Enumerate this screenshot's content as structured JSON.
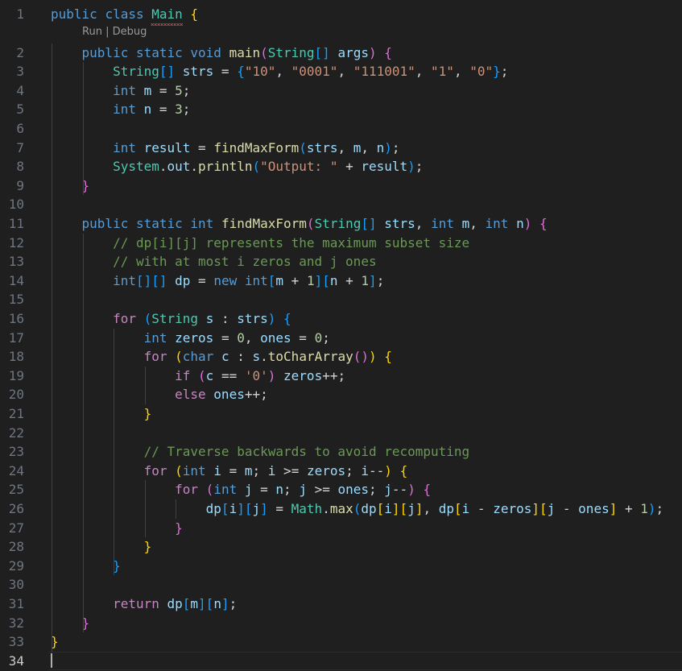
{
  "editor": {
    "language": "java",
    "codelens": {
      "run": "Run",
      "separator": " | ",
      "debug": "Debug"
    },
    "active_line": 34,
    "error_squiggle_on": "Main",
    "lines": [
      {
        "n": "1",
        "tokens": [
          [
            "kw",
            "public"
          ],
          [
            "pl",
            " "
          ],
          [
            "kw",
            "class"
          ],
          [
            "pl",
            " "
          ],
          [
            "ty",
            "Main"
          ],
          [
            "pl",
            " "
          ],
          [
            "b1",
            "{"
          ]
        ]
      },
      {
        "n": "2",
        "tokens": [
          [
            "pl",
            "    "
          ],
          [
            "kw",
            "public"
          ],
          [
            "pl",
            " "
          ],
          [
            "kw",
            "static"
          ],
          [
            "pl",
            " "
          ],
          [
            "kw",
            "void"
          ],
          [
            "pl",
            " "
          ],
          [
            "fn",
            "main"
          ],
          [
            "b2",
            "("
          ],
          [
            "ty",
            "String"
          ],
          [
            "b3",
            "[]"
          ],
          [
            "pl",
            " "
          ],
          [
            "var",
            "args"
          ],
          [
            "b2",
            ")"
          ],
          [
            "pl",
            " "
          ],
          [
            "b2",
            "{"
          ]
        ]
      },
      {
        "n": "3",
        "tokens": [
          [
            "pl",
            "        "
          ],
          [
            "ty",
            "String"
          ],
          [
            "b3",
            "[]"
          ],
          [
            "pl",
            " "
          ],
          [
            "var",
            "strs"
          ],
          [
            "pl",
            " = "
          ],
          [
            "b3",
            "{"
          ],
          [
            "str",
            "\"10\""
          ],
          [
            "pl",
            ", "
          ],
          [
            "str",
            "\"0001\""
          ],
          [
            "pl",
            ", "
          ],
          [
            "str",
            "\"111001\""
          ],
          [
            "pl",
            ", "
          ],
          [
            "str",
            "\"1\""
          ],
          [
            "pl",
            ", "
          ],
          [
            "str",
            "\"0\""
          ],
          [
            "b3",
            "}"
          ],
          [
            "pl",
            ";"
          ]
        ]
      },
      {
        "n": "4",
        "tokens": [
          [
            "pl",
            "        "
          ],
          [
            "kw",
            "int"
          ],
          [
            "pl",
            " "
          ],
          [
            "var",
            "m"
          ],
          [
            "pl",
            " = "
          ],
          [
            "num",
            "5"
          ],
          [
            "pl",
            ";"
          ]
        ]
      },
      {
        "n": "5",
        "tokens": [
          [
            "pl",
            "        "
          ],
          [
            "kw",
            "int"
          ],
          [
            "pl",
            " "
          ],
          [
            "var",
            "n"
          ],
          [
            "pl",
            " = "
          ],
          [
            "num",
            "3"
          ],
          [
            "pl",
            ";"
          ]
        ]
      },
      {
        "n": "6",
        "tokens": []
      },
      {
        "n": "7",
        "tokens": [
          [
            "pl",
            "        "
          ],
          [
            "kw",
            "int"
          ],
          [
            "pl",
            " "
          ],
          [
            "var",
            "result"
          ],
          [
            "pl",
            " = "
          ],
          [
            "fn",
            "findMaxForm"
          ],
          [
            "b3",
            "("
          ],
          [
            "var",
            "strs"
          ],
          [
            "pl",
            ", "
          ],
          [
            "var",
            "m"
          ],
          [
            "pl",
            ", "
          ],
          [
            "var",
            "n"
          ],
          [
            "b3",
            ")"
          ],
          [
            "pl",
            ";"
          ]
        ]
      },
      {
        "n": "8",
        "tokens": [
          [
            "pl",
            "        "
          ],
          [
            "ty",
            "System"
          ],
          [
            "pl",
            "."
          ],
          [
            "var",
            "out"
          ],
          [
            "pl",
            "."
          ],
          [
            "fn",
            "println"
          ],
          [
            "b3",
            "("
          ],
          [
            "str",
            "\"Output: \""
          ],
          [
            "pl",
            " + "
          ],
          [
            "var",
            "result"
          ],
          [
            "b3",
            ")"
          ],
          [
            "pl",
            ";"
          ]
        ]
      },
      {
        "n": "9",
        "tokens": [
          [
            "pl",
            "    "
          ],
          [
            "b2",
            "}"
          ]
        ]
      },
      {
        "n": "10",
        "tokens": []
      },
      {
        "n": "11",
        "tokens": [
          [
            "pl",
            "    "
          ],
          [
            "kw",
            "public"
          ],
          [
            "pl",
            " "
          ],
          [
            "kw",
            "static"
          ],
          [
            "pl",
            " "
          ],
          [
            "kw",
            "int"
          ],
          [
            "pl",
            " "
          ],
          [
            "fn",
            "findMaxForm"
          ],
          [
            "b2",
            "("
          ],
          [
            "ty",
            "String"
          ],
          [
            "b3",
            "[]"
          ],
          [
            "pl",
            " "
          ],
          [
            "var",
            "strs"
          ],
          [
            "pl",
            ", "
          ],
          [
            "kw",
            "int"
          ],
          [
            "pl",
            " "
          ],
          [
            "var",
            "m"
          ],
          [
            "pl",
            ", "
          ],
          [
            "kw",
            "int"
          ],
          [
            "pl",
            " "
          ],
          [
            "var",
            "n"
          ],
          [
            "b2",
            ")"
          ],
          [
            "pl",
            " "
          ],
          [
            "b2",
            "{"
          ]
        ]
      },
      {
        "n": "12",
        "tokens": [
          [
            "pl",
            "        "
          ],
          [
            "cm",
            "// dp[i][j] represents the maximum subset size"
          ]
        ]
      },
      {
        "n": "13",
        "tokens": [
          [
            "pl",
            "        "
          ],
          [
            "cm",
            "// with at most i zeros and j ones"
          ]
        ]
      },
      {
        "n": "14",
        "tokens": [
          [
            "pl",
            "        "
          ],
          [
            "kw",
            "int"
          ],
          [
            "b3",
            "[][]"
          ],
          [
            "pl",
            " "
          ],
          [
            "var",
            "dp"
          ],
          [
            "pl",
            " = "
          ],
          [
            "kw",
            "new"
          ],
          [
            "pl",
            " "
          ],
          [
            "kw",
            "int"
          ],
          [
            "b3",
            "["
          ],
          [
            "var",
            "m"
          ],
          [
            "pl",
            " + "
          ],
          [
            "num",
            "1"
          ],
          [
            "b3",
            "]["
          ],
          [
            "var",
            "n"
          ],
          [
            "pl",
            " + "
          ],
          [
            "num",
            "1"
          ],
          [
            "b3",
            "]"
          ],
          [
            "pl",
            ";"
          ]
        ]
      },
      {
        "n": "15",
        "tokens": []
      },
      {
        "n": "16",
        "tokens": [
          [
            "pl",
            "        "
          ],
          [
            "ctl",
            "for"
          ],
          [
            "pl",
            " "
          ],
          [
            "b3",
            "("
          ],
          [
            "ty",
            "String"
          ],
          [
            "pl",
            " "
          ],
          [
            "var",
            "s"
          ],
          [
            "pl",
            " : "
          ],
          [
            "var",
            "strs"
          ],
          [
            "b3",
            ")"
          ],
          [
            "pl",
            " "
          ],
          [
            "b3",
            "{"
          ]
        ]
      },
      {
        "n": "17",
        "tokens": [
          [
            "pl",
            "            "
          ],
          [
            "kw",
            "int"
          ],
          [
            "pl",
            " "
          ],
          [
            "var",
            "zeros"
          ],
          [
            "pl",
            " = "
          ],
          [
            "num",
            "0"
          ],
          [
            "pl",
            ", "
          ],
          [
            "var",
            "ones"
          ],
          [
            "pl",
            " = "
          ],
          [
            "num",
            "0"
          ],
          [
            "pl",
            ";"
          ]
        ]
      },
      {
        "n": "18",
        "tokens": [
          [
            "pl",
            "            "
          ],
          [
            "ctl",
            "for"
          ],
          [
            "pl",
            " "
          ],
          [
            "b1",
            "("
          ],
          [
            "kw",
            "char"
          ],
          [
            "pl",
            " "
          ],
          [
            "var",
            "c"
          ],
          [
            "pl",
            " : "
          ],
          [
            "var",
            "s"
          ],
          [
            "pl",
            "."
          ],
          [
            "fn",
            "toCharArray"
          ],
          [
            "b2",
            "()"
          ],
          [
            "b1",
            ")"
          ],
          [
            "pl",
            " "
          ],
          [
            "b1",
            "{"
          ]
        ]
      },
      {
        "n": "19",
        "tokens": [
          [
            "pl",
            "                "
          ],
          [
            "ctl",
            "if"
          ],
          [
            "pl",
            " "
          ],
          [
            "b2",
            "("
          ],
          [
            "var",
            "c"
          ],
          [
            "pl",
            " == "
          ],
          [
            "str",
            "'0'"
          ],
          [
            "b2",
            ")"
          ],
          [
            "pl",
            " "
          ],
          [
            "var",
            "zeros"
          ],
          [
            "pl",
            "++;"
          ]
        ]
      },
      {
        "n": "20",
        "tokens": [
          [
            "pl",
            "                "
          ],
          [
            "ctl",
            "else"
          ],
          [
            "pl",
            " "
          ],
          [
            "var",
            "ones"
          ],
          [
            "pl",
            "++;"
          ]
        ]
      },
      {
        "n": "21",
        "tokens": [
          [
            "pl",
            "            "
          ],
          [
            "b1",
            "}"
          ]
        ]
      },
      {
        "n": "22",
        "tokens": []
      },
      {
        "n": "23",
        "tokens": [
          [
            "pl",
            "            "
          ],
          [
            "cm",
            "// Traverse backwards to avoid recomputing"
          ]
        ]
      },
      {
        "n": "24",
        "tokens": [
          [
            "pl",
            "            "
          ],
          [
            "ctl",
            "for"
          ],
          [
            "pl",
            " "
          ],
          [
            "b1",
            "("
          ],
          [
            "kw",
            "int"
          ],
          [
            "pl",
            " "
          ],
          [
            "var",
            "i"
          ],
          [
            "pl",
            " = "
          ],
          [
            "var",
            "m"
          ],
          [
            "pl",
            "; "
          ],
          [
            "var",
            "i"
          ],
          [
            "pl",
            " >= "
          ],
          [
            "var",
            "zeros"
          ],
          [
            "pl",
            "; "
          ],
          [
            "var",
            "i"
          ],
          [
            "pl",
            "--"
          ],
          [
            "b1",
            ")"
          ],
          [
            "pl",
            " "
          ],
          [
            "b1",
            "{"
          ]
        ]
      },
      {
        "n": "25",
        "tokens": [
          [
            "pl",
            "                "
          ],
          [
            "ctl",
            "for"
          ],
          [
            "pl",
            " "
          ],
          [
            "b2",
            "("
          ],
          [
            "kw",
            "int"
          ],
          [
            "pl",
            " "
          ],
          [
            "var",
            "j"
          ],
          [
            "pl",
            " = "
          ],
          [
            "var",
            "n"
          ],
          [
            "pl",
            "; "
          ],
          [
            "var",
            "j"
          ],
          [
            "pl",
            " >= "
          ],
          [
            "var",
            "ones"
          ],
          [
            "pl",
            "; "
          ],
          [
            "var",
            "j"
          ],
          [
            "pl",
            "--"
          ],
          [
            "b2",
            ")"
          ],
          [
            "pl",
            " "
          ],
          [
            "b2",
            "{"
          ]
        ]
      },
      {
        "n": "26",
        "tokens": [
          [
            "pl",
            "                    "
          ],
          [
            "var",
            "dp"
          ],
          [
            "b3",
            "["
          ],
          [
            "var",
            "i"
          ],
          [
            "b3",
            "]["
          ],
          [
            "var",
            "j"
          ],
          [
            "b3",
            "]"
          ],
          [
            "pl",
            " = "
          ],
          [
            "ty",
            "Math"
          ],
          [
            "pl",
            "."
          ],
          [
            "fn",
            "max"
          ],
          [
            "b3",
            "("
          ],
          [
            "var",
            "dp"
          ],
          [
            "b1",
            "["
          ],
          [
            "var",
            "i"
          ],
          [
            "b1",
            "]["
          ],
          [
            "var",
            "j"
          ],
          [
            "b1",
            "]"
          ],
          [
            "pl",
            ", "
          ],
          [
            "var",
            "dp"
          ],
          [
            "b1",
            "["
          ],
          [
            "var",
            "i"
          ],
          [
            "pl",
            " - "
          ],
          [
            "var",
            "zeros"
          ],
          [
            "b1",
            "]["
          ],
          [
            "var",
            "j"
          ],
          [
            "pl",
            " - "
          ],
          [
            "var",
            "ones"
          ],
          [
            "b1",
            "]"
          ],
          [
            "pl",
            " + "
          ],
          [
            "num",
            "1"
          ],
          [
            "b3",
            ")"
          ],
          [
            "pl",
            ";"
          ]
        ]
      },
      {
        "n": "27",
        "tokens": [
          [
            "pl",
            "                "
          ],
          [
            "b2",
            "}"
          ]
        ]
      },
      {
        "n": "28",
        "tokens": [
          [
            "pl",
            "            "
          ],
          [
            "b1",
            "}"
          ]
        ]
      },
      {
        "n": "29",
        "tokens": [
          [
            "pl",
            "        "
          ],
          [
            "b3",
            "}"
          ]
        ]
      },
      {
        "n": "30",
        "tokens": []
      },
      {
        "n": "31",
        "tokens": [
          [
            "pl",
            "        "
          ],
          [
            "ctl",
            "return"
          ],
          [
            "pl",
            " "
          ],
          [
            "var",
            "dp"
          ],
          [
            "b3",
            "["
          ],
          [
            "var",
            "m"
          ],
          [
            "b3",
            "]["
          ],
          [
            "var",
            "n"
          ],
          [
            "b3",
            "]"
          ],
          [
            "pl",
            ";"
          ]
        ]
      },
      {
        "n": "32",
        "tokens": [
          [
            "pl",
            "    "
          ],
          [
            "b2",
            "}"
          ]
        ]
      },
      {
        "n": "33",
        "tokens": [
          [
            "b1",
            "}"
          ]
        ]
      },
      {
        "n": "34",
        "tokens": []
      }
    ]
  }
}
